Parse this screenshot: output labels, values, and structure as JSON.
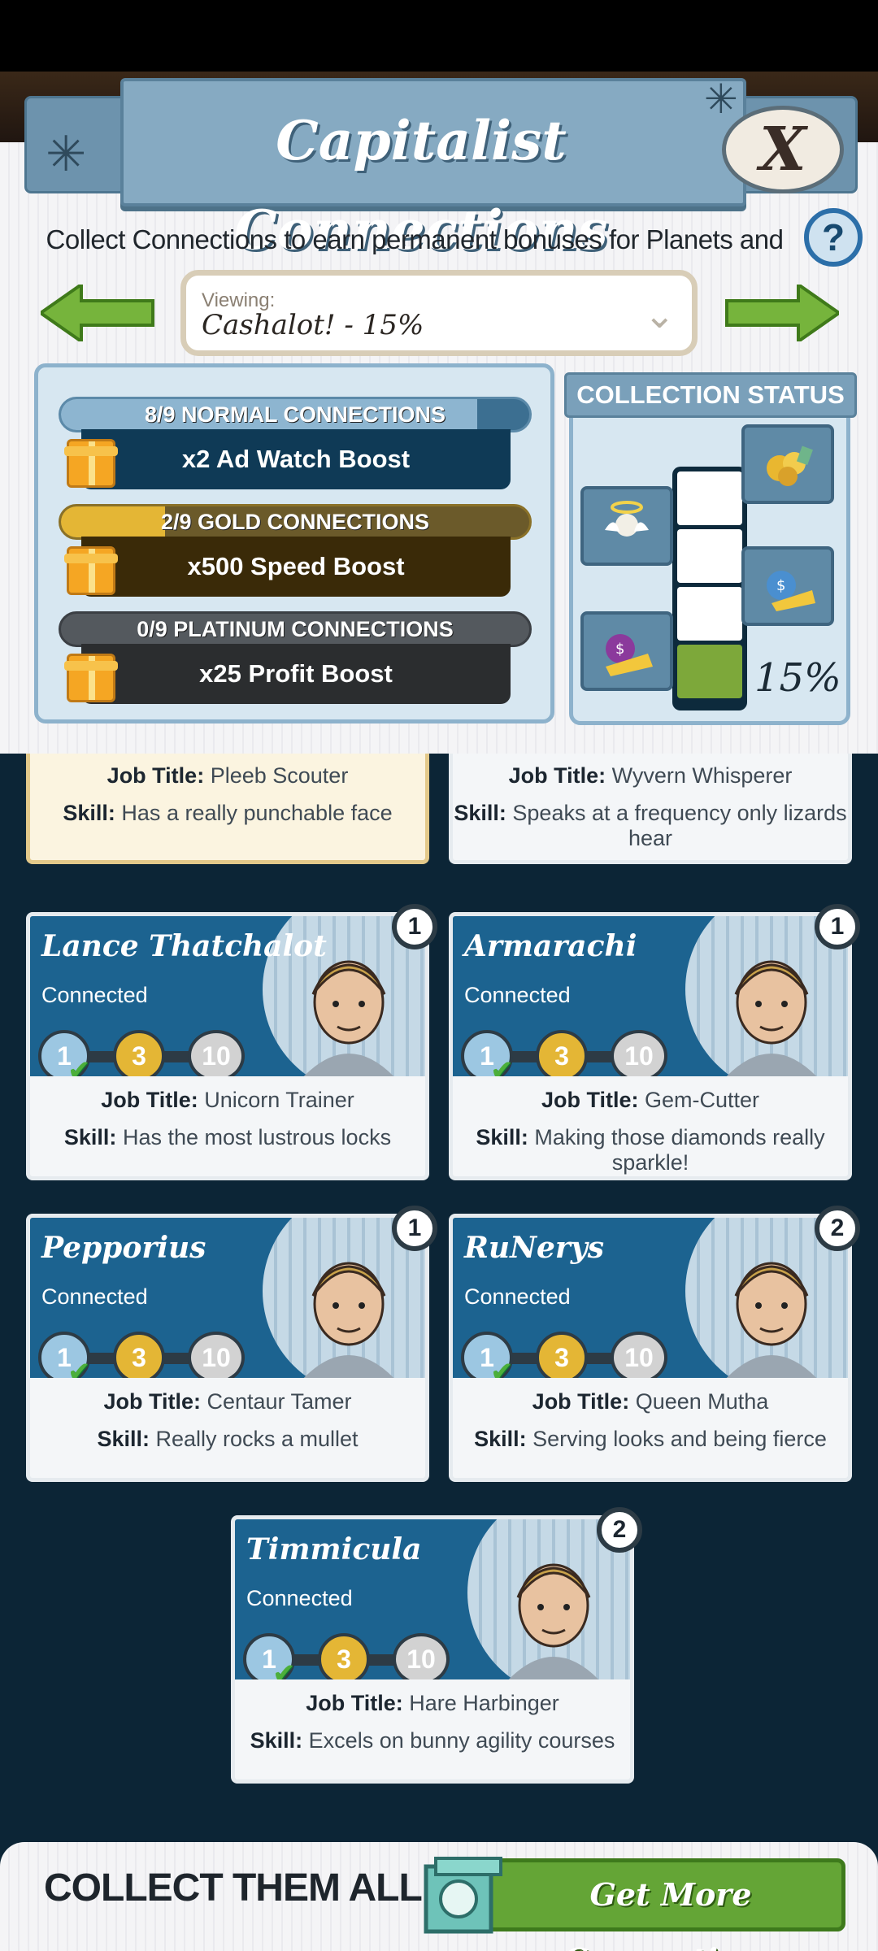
{
  "header": {
    "title": "Capitalist Connections",
    "close_label": "X",
    "subtitle": "Collect Connections to earn permanent bonuses for Planets and Events!",
    "help_label": "?"
  },
  "viewing": {
    "label": "Viewing:",
    "value": "Cashalot! - 15%"
  },
  "connections": [
    {
      "label": "8/9 NORMAL CONNECTIONS",
      "boost": "x2 Ad Watch Boost",
      "progress": 0.889
    },
    {
      "label": "2/9 GOLD CONNECTIONS",
      "boost": "x500 Speed Boost",
      "progress": 0.222
    },
    {
      "label": "0/9 PLATINUM CONNECTIONS",
      "boost": "x25 Profit Boost",
      "progress": 0.0
    }
  ],
  "collection_status": {
    "title": "COLLECTION STATUS",
    "percent": "15%",
    "progress": 0.15
  },
  "partial_cards": [
    {
      "job_label": "Job Title:",
      "job": "Pleeb Scouter",
      "skill_label": "Skill:",
      "skill": "Has a really punchable face"
    },
    {
      "job_label": "Job Title:",
      "job": "Wyvern Whisperer",
      "skill_label": "Skill:",
      "skill": "Speaks at a frequency only lizards hear"
    }
  ],
  "cards": [
    {
      "name": "Lance Thatchalot",
      "status": "Connected",
      "level": "1",
      "tiers": [
        "1",
        "3",
        "10"
      ],
      "job_label": "Job Title:",
      "job": "Unicorn Trainer",
      "skill_label": "Skill:",
      "skill": "Has the most lustrous locks"
    },
    {
      "name": "Armarachi",
      "status": "Connected",
      "level": "1",
      "tiers": [
        "1",
        "3",
        "10"
      ],
      "job_label": "Job Title:",
      "job": "Gem-Cutter",
      "skill_label": "Skill:",
      "skill": "Making those diamonds really sparkle!"
    },
    {
      "name": "Pepporius",
      "status": "Connected",
      "level": "1",
      "tiers": [
        "1",
        "3",
        "10"
      ],
      "job_label": "Job Title:",
      "job": "Centaur Tamer",
      "skill_label": "Skill:",
      "skill": "Really rocks a mullet"
    },
    {
      "name": "RuNerys",
      "status": "Connected",
      "level": "2",
      "tiers": [
        "1",
        "3",
        "10"
      ],
      "job_label": "Job Title:",
      "job": "Queen Mutha",
      "skill_label": "Skill:",
      "skill": "Serving looks and being fierce"
    },
    {
      "name": "Timmicula",
      "status": "Connected",
      "level": "2",
      "tiers": [
        "1",
        "3",
        "10"
      ],
      "job_label": "Job Title:",
      "job": "Hare Harbinger",
      "skill_label": "Skill:",
      "skill": "Excels on bunny agility courses"
    }
  ],
  "footer": {
    "text": "COLLECT THEM ALL!",
    "button_label": "Get More Connections"
  },
  "colors": {
    "accent_blue": "#1c6390",
    "gold": "#e4b635",
    "green": "#64a536",
    "dark_bg": "#0c2536"
  }
}
